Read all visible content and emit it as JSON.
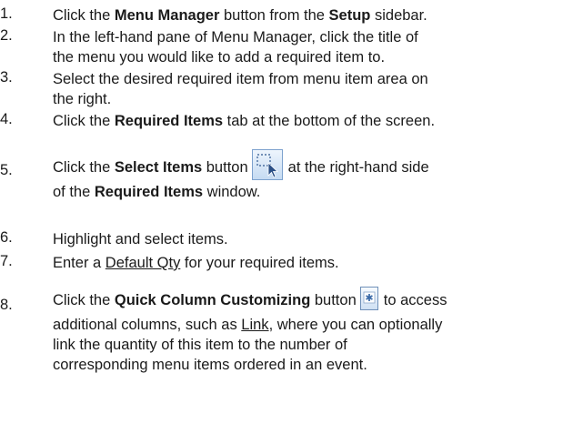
{
  "steps": [
    {
      "num": "1.",
      "parts": [
        "Click the ",
        "Menu Manager",
        " button from the ",
        "Setup",
        " sidebar."
      ]
    },
    {
      "num": "2.",
      "lines": [
        "In the left-hand pane of Menu Manager, click the title of",
        "the menu you would like to add a required item to."
      ]
    },
    {
      "num": "3.",
      "lines": [
        "Select the desired required item from menu item area on",
        "the right."
      ]
    },
    {
      "num": "4.",
      "parts": [
        "Click the ",
        "Required Items",
        " tab at the bottom of the screen."
      ]
    },
    {
      "num": "5.",
      "parts": [
        "Click the ",
        "Select Items",
        " button",
        "at the right-hand side"
      ],
      "line2": [
        "of the ",
        "Required Items",
        " window."
      ]
    },
    {
      "num": "6.",
      "text": "Highlight and select items."
    },
    {
      "num": "7.",
      "parts": [
        "Enter a ",
        "Default Qty",
        " for your required items."
      ]
    },
    {
      "num": "8.",
      "parts": [
        "Click the ",
        "Quick Column Customizing",
        " button",
        "to access"
      ],
      "lines": [
        "additional columns, such as ",
        "Link",
        ", where you can optionally",
        "link the quantity of this item to the number of",
        "corresponding menu items ordered in an event."
      ]
    }
  ],
  "icons": {
    "select_items": "select-items-icon",
    "quick_column": "quick-column-customizing-icon"
  }
}
